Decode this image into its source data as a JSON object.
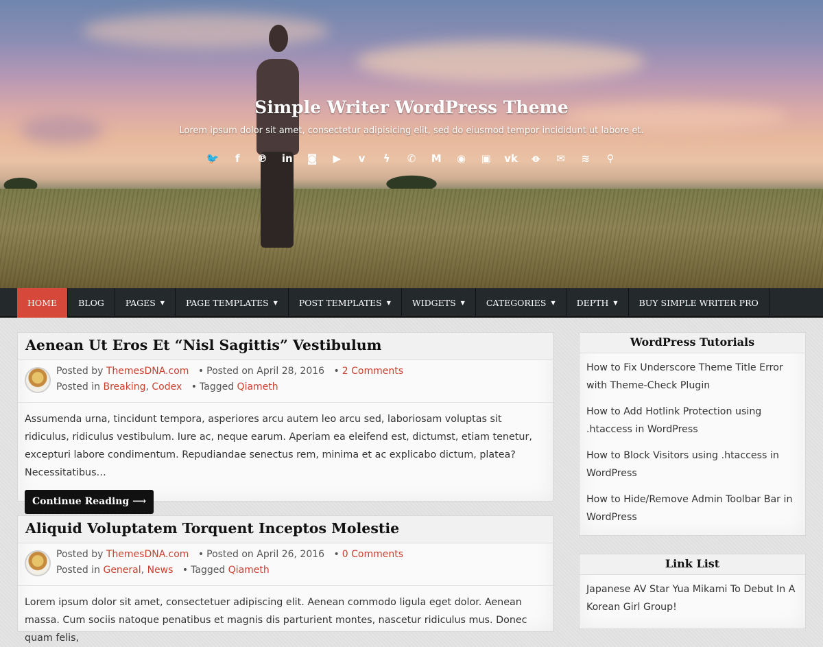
{
  "header": {
    "title": "Simple Writer WordPress Theme",
    "description": "Lorem ipsum dolor sit amet, consectetur adipisicing elit, sed do eiusmod tempor incididunt ut labore et.",
    "social_icons": [
      {
        "name": "twitter-icon",
        "glyph": "🐦"
      },
      {
        "name": "facebook-icon",
        "glyph": "f"
      },
      {
        "name": "pinterest-icon",
        "glyph": "℗"
      },
      {
        "name": "linkedin-icon",
        "glyph": "in"
      },
      {
        "name": "instagram-icon",
        "glyph": "◙"
      },
      {
        "name": "youtube-icon",
        "glyph": "▶"
      },
      {
        "name": "vimeo-icon",
        "glyph": "v"
      },
      {
        "name": "messenger-icon",
        "glyph": "ϟ"
      },
      {
        "name": "whatsapp-icon",
        "glyph": "✆"
      },
      {
        "name": "medium-icon",
        "glyph": "M"
      },
      {
        "name": "github-icon",
        "glyph": "◉"
      },
      {
        "name": "flipboard-icon",
        "glyph": "▣"
      },
      {
        "name": "vk-icon",
        "glyph": "vk"
      },
      {
        "name": "odnoklassniki-icon",
        "glyph": "ꝋ"
      },
      {
        "name": "email-icon",
        "glyph": "✉"
      },
      {
        "name": "rss-icon",
        "glyph": "≋"
      },
      {
        "name": "search-icon",
        "glyph": "⚲"
      }
    ]
  },
  "nav": {
    "items": [
      {
        "label": "HOME",
        "active": true,
        "caret": false
      },
      {
        "label": "BLOG",
        "active": false,
        "caret": false
      },
      {
        "label": "PAGES",
        "active": false,
        "caret": true
      },
      {
        "label": "PAGE TEMPLATES",
        "active": false,
        "caret": true
      },
      {
        "label": "POST TEMPLATES",
        "active": false,
        "caret": true
      },
      {
        "label": "WIDGETS",
        "active": false,
        "caret": true
      },
      {
        "label": "CATEGORIES",
        "active": false,
        "caret": true
      },
      {
        "label": "DEPTH",
        "active": false,
        "caret": true
      },
      {
        "label": "BUY SIMPLE WRITER PRO",
        "active": false,
        "caret": false
      }
    ],
    "caret_glyph": "▼",
    "active_color": "#d5483a",
    "bar_color": "#24292c"
  },
  "posts": [
    {
      "title": "Aenean Ut Eros Et “Nisl Sagittis” Vestibulum",
      "posted_by_label": "Posted by",
      "author": "ThemesDNA.com",
      "posted_on_label": "Posted on",
      "date": "April 28, 2016",
      "comments": "2 Comments",
      "posted_in_label": "Posted in",
      "categories": [
        "Breaking",
        "Codex"
      ],
      "tagged_label": "Tagged",
      "tags": [
        "Qiameth"
      ],
      "excerpt": "Assumenda urna, tincidunt tempora, asperiores arcu autem leo arcu sed, laboriosam voluptas sit ridiculus, ridiculus vestibulum. Iure ac, neque earum. Aperiam ea eleifend est, dictumst, etiam tenetur, excepturi labore condimentum. Repudiandae senectus rem, minima et ac explicabo dictum, platea? Necessitatibus…",
      "more_label": "Continue Reading ⟶"
    },
    {
      "title": "Aliquid Voluptatem Torquent Inceptos Molestie",
      "posted_by_label": "Posted by",
      "author": "ThemesDNA.com",
      "posted_on_label": "Posted on",
      "date": "April 26, 2016",
      "comments": "0 Comments",
      "posted_in_label": "Posted in",
      "categories": [
        "General",
        "News"
      ],
      "tagged_label": "Tagged",
      "tags": [
        "Qiameth"
      ],
      "excerpt": "Lorem ipsum dolor sit amet, consectetuer adipiscing elit. Aenean commodo ligula eget dolor. Aenean massa. Cum sociis natoque penatibus et magnis dis parturient montes, nascetur ridiculus mus. Donec quam felis,"
    }
  ],
  "sidebar": {
    "widgets": [
      {
        "title": "WordPress Tutorials",
        "items": [
          "How to Fix Underscore Theme Title Error with Theme-Check Plugin",
          "How to Add Hotlink Protection using .htaccess in WordPress",
          "How to Block Visitors using .htaccess in WordPress",
          "How to Hide/Remove Admin Toolbar Bar in WordPress"
        ]
      },
      {
        "title": "Link List",
        "items": [
          "Japanese AV Star Yua Mikami To Debut In A Korean Girl Group!"
        ]
      }
    ]
  }
}
